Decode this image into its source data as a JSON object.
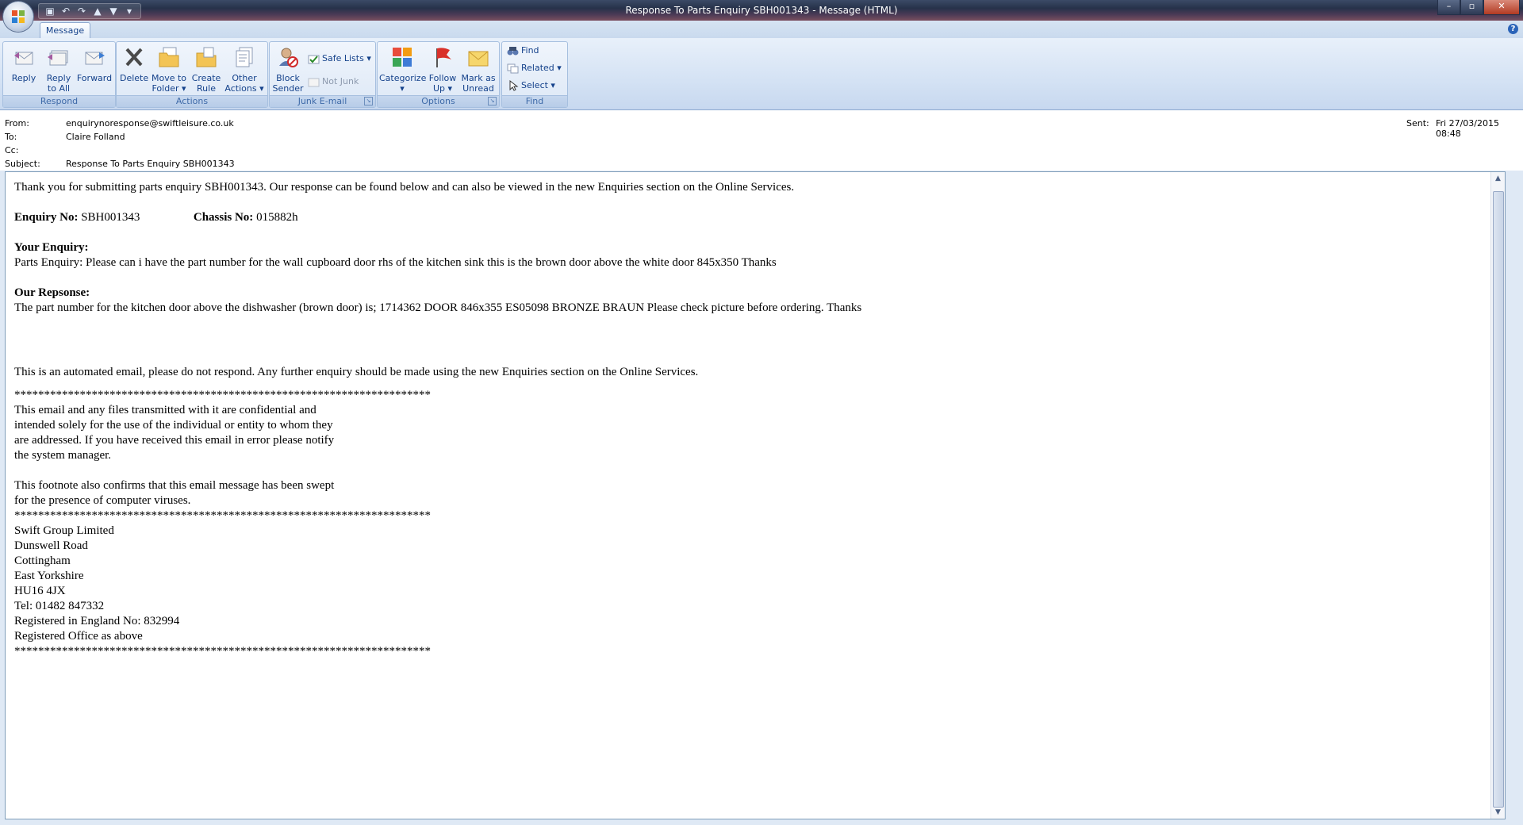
{
  "window": {
    "title": "Response To Parts Enquiry SBH001343 - Message (HTML)",
    "controls": {
      "minimize": "–",
      "maximize": "▫",
      "close": "✕"
    }
  },
  "qat": {
    "save": "💾",
    "undo": "↶",
    "redo": "↷",
    "up": "▲",
    "down": "▼",
    "customize": "▾"
  },
  "tabs": {
    "message": "Message",
    "help": "?"
  },
  "ribbon": {
    "respond": {
      "label": "Respond",
      "reply": "Reply",
      "reply_all_1": "Reply",
      "reply_all_2": "to All",
      "forward": "Forward"
    },
    "actions": {
      "label": "Actions",
      "delete": "Delete",
      "move_1": "Move to",
      "move_2": "Folder ▾",
      "create_1": "Create",
      "create_2": "Rule",
      "other_1": "Other",
      "other_2": "Actions ▾"
    },
    "junk": {
      "label": "Junk E-mail",
      "block_1": "Block",
      "block_2": "Sender",
      "safe_lists": "Safe Lists ▾",
      "not_junk": "Not Junk"
    },
    "options": {
      "label": "Options",
      "categorize_1": "Categorize",
      "categorize_2": "▾",
      "follow_1": "Follow",
      "follow_2": "Up ▾",
      "mark_1": "Mark as",
      "mark_2": "Unread"
    },
    "find": {
      "label": "Find",
      "find": "Find",
      "related": "Related ▾",
      "select": "Select ▾"
    }
  },
  "header": {
    "from_label": "From:",
    "from": "enquirynoresponse@swiftleisure.co.uk",
    "to_label": "To:",
    "to": "Claire Folland",
    "cc_label": "Cc:",
    "cc": "",
    "subject_label": "Subject:",
    "subject": "Response To Parts Enquiry SBH001343",
    "sent_label": "Sent:",
    "sent": "Fri 27/03/2015 08:48"
  },
  "body": {
    "intro": "Thank you for submitting parts enquiry SBH001343. Our response can be found below and can also be viewed in the new Enquiries section on the Online Services.",
    "enquiry_no_label": "Enquiry No:",
    "enquiry_no": "SBH001343",
    "chassis_no_label": "Chassis No:",
    "chassis_no": "015882h",
    "your_enquiry_heading": "Your Enquiry:",
    "your_enquiry": "Parts Enquiry: Please can i have the part number for the wall cupboard door rhs of the kitchen sink this is the brown door above the white door 845x350 Thanks",
    "our_response_heading": "Our Repsonse:",
    "our_response": "The part number for the kitchen door above the dishwasher (brown door) is; 1714362 DOOR 846x355 ES05098 BRONZE BRAUN Please check picture before ordering. Thanks",
    "automated": "This is an automated email, please do not respond. Any further enquiry should be made using the new Enquiries section on the Online Services.",
    "stars": "**********************************************************************",
    "conf_1": "This email and any files transmitted with it are confidential and",
    "conf_2": "intended solely for the use of the individual or entity to whom they",
    "conf_3": "are addressed. If you have received this email in error please notify",
    "conf_4": "the system manager.",
    "foot_1": "This footnote also confirms that this email message has been swept",
    "foot_2": "for the presence of computer viruses.",
    "addr_1": "Swift Group Limited",
    "addr_2": "Dunswell Road",
    "addr_3": "Cottingham",
    "addr_4": "East Yorkshire",
    "addr_5": "HU16 4JX",
    "addr_6": "Tel: 01482 847332",
    "addr_7": "Registered in England No: 832994",
    "addr_8": "Registered Office as above"
  }
}
